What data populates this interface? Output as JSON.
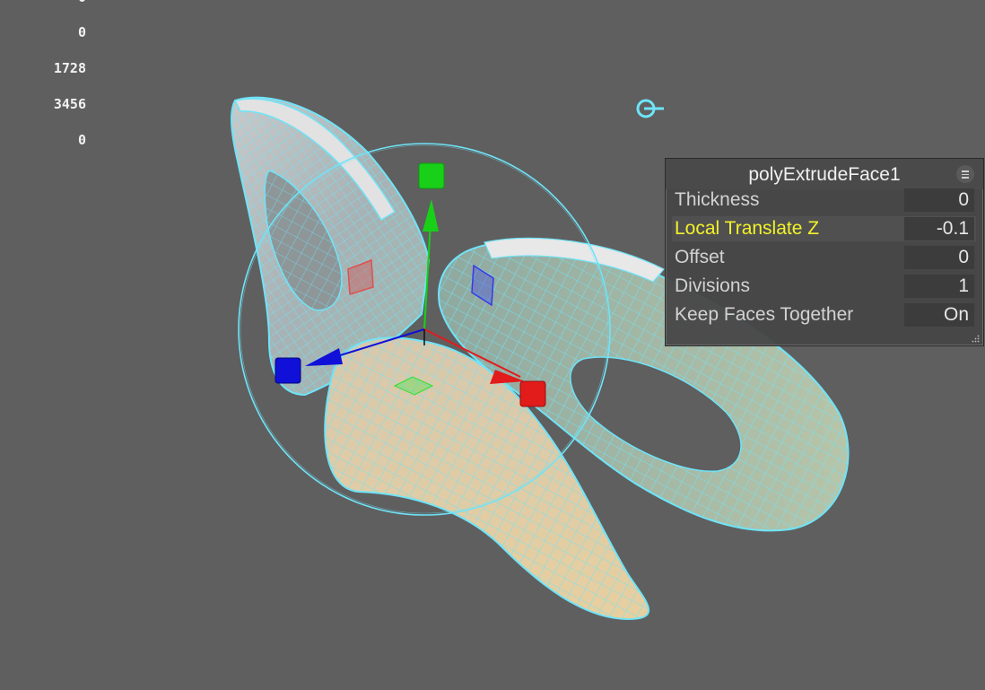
{
  "hud": {
    "counters": [
      "0",
      "0",
      "1728",
      "3456",
      "0"
    ]
  },
  "colors": {
    "viewport_bg": "#5f5f5f",
    "wireframe": "#6fe4f8",
    "axis_x": "#e21b1b",
    "axis_y": "#19d019",
    "axis_z": "#1010d8",
    "active_label": "#f2f22a"
  },
  "icons": {
    "pivot": "camera-pivot-icon",
    "menu": "panel-menu-icon",
    "grip": "resize-grip-icon"
  },
  "editor": {
    "title": "polyExtrudeFace1",
    "rows": [
      {
        "label": "Thickness",
        "value": "0"
      },
      {
        "label": "Local Translate Z",
        "value": "-0.1",
        "active": true
      },
      {
        "label": "Offset",
        "value": "0"
      },
      {
        "label": "Divisions",
        "value": "1"
      },
      {
        "label": "Keep Faces Together",
        "value": "On"
      }
    ]
  }
}
